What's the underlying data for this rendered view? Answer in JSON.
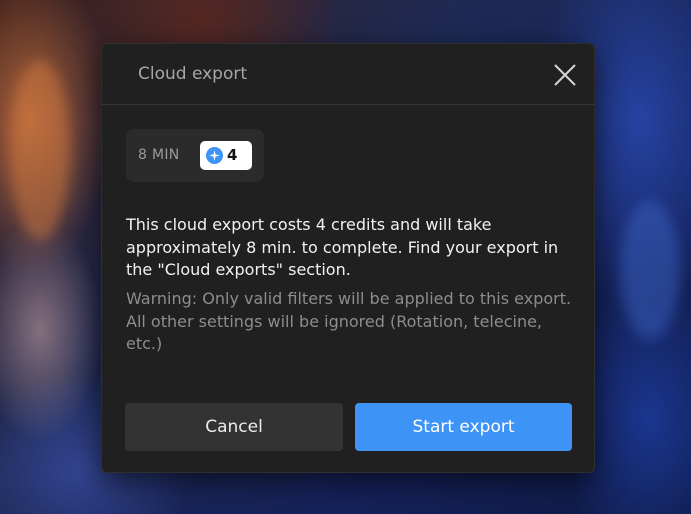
{
  "dialog": {
    "title": "Cloud export",
    "close_icon": "close-icon",
    "estimate": {
      "time": "8 MIN",
      "credits": "4",
      "credit_icon": "credit-icon"
    },
    "message": "This cloud export costs 4 credits and will take approximately 8 min. to complete. Find your export in the \"Cloud exports\" section.",
    "warning": "Warning: Only valid filters will be applied to this export. All other settings will be ignored (Rotation, telecine, etc.)",
    "cancel_label": "Cancel",
    "start_label": "Start export"
  },
  "colors": {
    "dialog_bg": "#202020",
    "primary": "#3d94f6",
    "secondary_button": "#333333",
    "muted_text": "#8d8d8d"
  }
}
